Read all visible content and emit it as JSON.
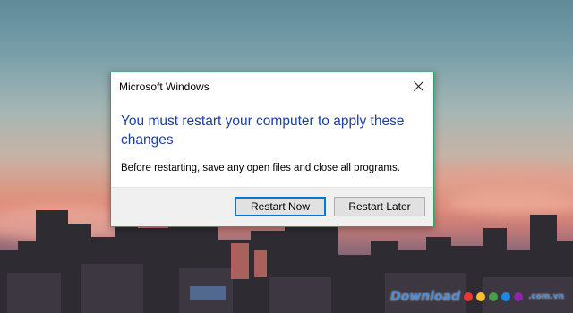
{
  "dialog": {
    "title": "Microsoft Windows",
    "heading": "You must restart your computer to apply these changes",
    "message": "Before restarting, save any open files and close all programs.",
    "close_icon": "close-icon",
    "buttons": {
      "restart_now": "Restart Now",
      "restart_later": "Restart Later"
    }
  },
  "watermark": {
    "text": "Download",
    "suffix": ".com.vn",
    "dot_colors": [
      "#e53935",
      "#fbc02d",
      "#43a047",
      "#1e88e5",
      "#8e24aa"
    ]
  },
  "colors": {
    "heading": "#1a3fa6",
    "dialog_border": "#2fa36a",
    "default_button_border": "#0078d7",
    "footer_bg": "#f0f0f0"
  }
}
